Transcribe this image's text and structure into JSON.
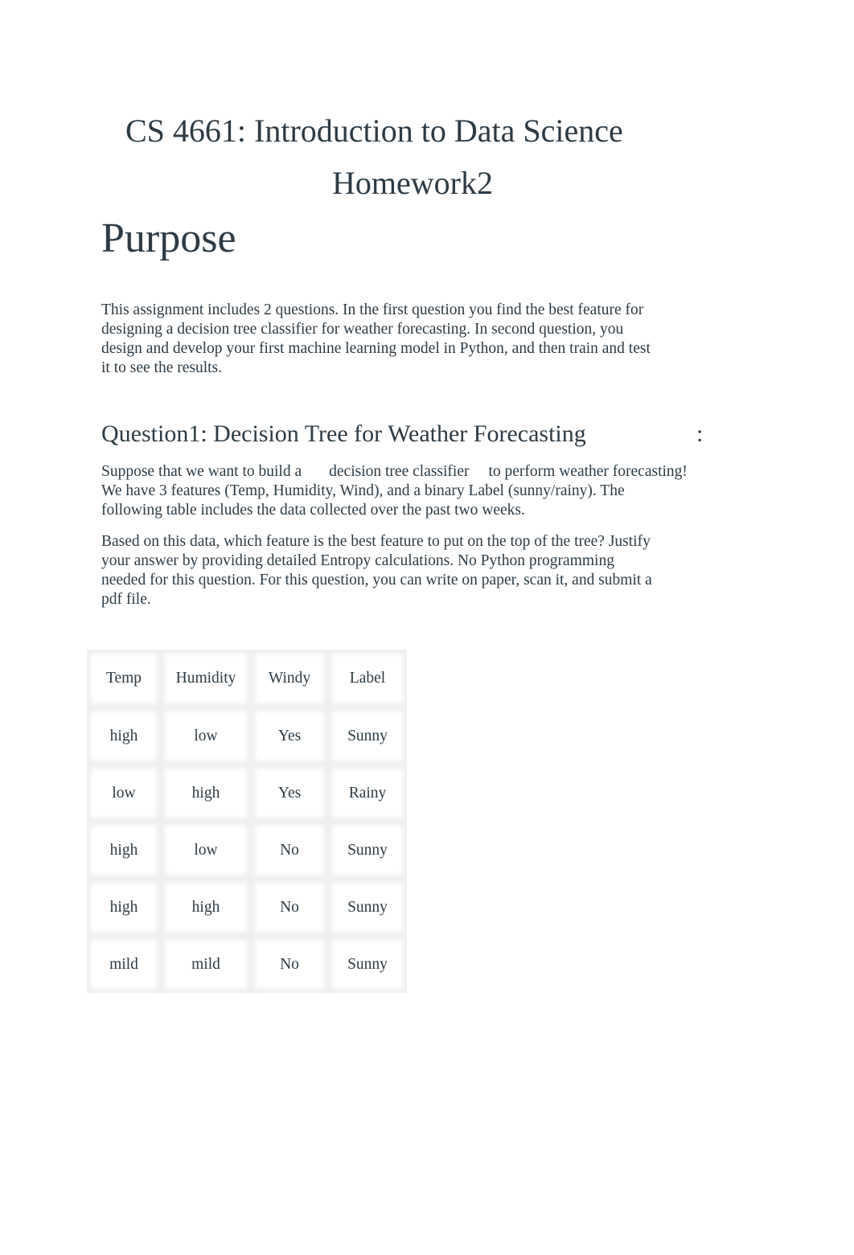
{
  "document": {
    "title_line1": "CS 4661: Introduction to Data Science",
    "title_line2": "Homework2",
    "purpose": {
      "heading": "Purpose",
      "lines": [
        "This assignment includes 2 questions. In the first question you find the best feature for",
        "designing a decision tree classifier for weather forecasting. In second question, you",
        "design and develop your first machine learning model in Python, and then train and test",
        "it to see the results."
      ]
    },
    "question1": {
      "heading": "Question1: Decision Tree for Weather Forecasting",
      "heading_suffix": ":",
      "intro": {
        "line1_part1": "Suppose that we want to build a",
        "line1_part2": "decision tree classifier",
        "line1_part3": "to perform weather forecasting!",
        "line2": "We have 3 features (Temp, Humidity, Wind), and a binary Label (sunny/rainy). The",
        "line3": "following table includes the data collected over the past two weeks."
      },
      "task_lines": [
        "Based on this data, which feature is the best feature to put on the top of the tree? Justify",
        "your answer by providing detailed Entropy calculations. No Python programming",
        "needed for this question. For this question, you can write on paper, scan it, and submit a",
        "pdf file."
      ],
      "table": {
        "headers": [
          "Temp",
          "Humidity",
          "Windy",
          "Label"
        ],
        "rows": [
          [
            "high",
            "low",
            "Yes",
            "Sunny"
          ],
          [
            "low",
            "high",
            "Yes",
            "Rainy"
          ],
          [
            "high",
            "low",
            "No",
            "Sunny"
          ],
          [
            "high",
            "high",
            "No",
            "Sunny"
          ],
          [
            "mild",
            "mild",
            "No",
            "Sunny"
          ]
        ]
      }
    }
  }
}
